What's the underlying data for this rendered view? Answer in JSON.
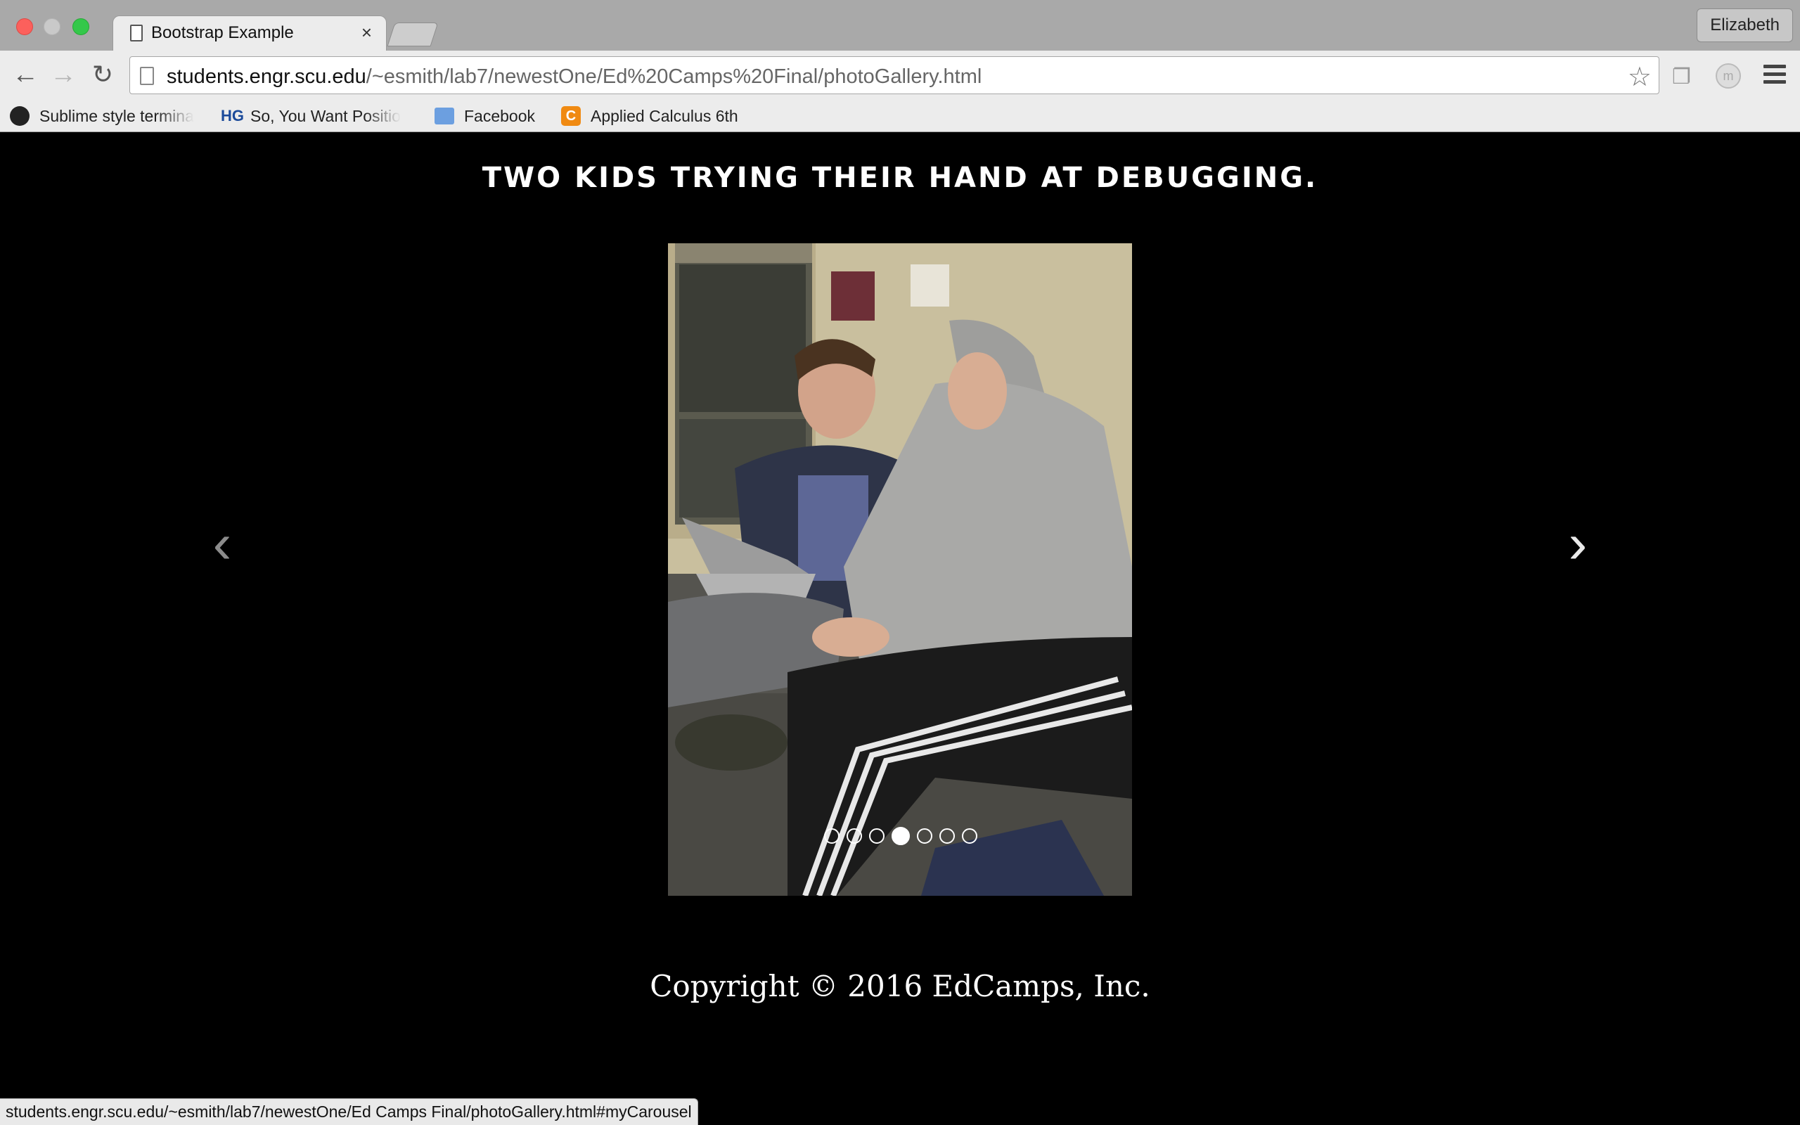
{
  "window": {
    "tab_title": "Bootstrap Example",
    "tab_close": "×",
    "profile_name": "Elizabeth"
  },
  "toolbar": {
    "back_icon": "←",
    "forward_icon": "→",
    "reload_icon": "↻",
    "url_host": "students.engr.scu.edu",
    "url_path": "/~esmith/lab7/newestOne/Ed%20Camps%20Final/photoGallery.html",
    "star_icon": "☆"
  },
  "bookmarks": [
    {
      "label": "Sublime style termina",
      "icon": "github-icon"
    },
    {
      "label": "So, You Want Positio",
      "icon": "hg-icon",
      "glyph": "HG"
    },
    {
      "label": "Facebook",
      "icon": "folder-icon"
    },
    {
      "label": "Applied Calculus 6th",
      "icon": "c-icon",
      "glyph": "C"
    }
  ],
  "page": {
    "caption": "TWO KIDS TRYING THEIR HAND AT DEBUGGING.",
    "prev_icon": "‹",
    "next_icon": "›",
    "copyright": "Copyright © 2016 EdCamps, Inc."
  },
  "carousel": {
    "slide_count": 7,
    "active_index": 3
  },
  "status_bar": {
    "text": "students.engr.scu.edu/~esmith/lab7/newestOne/Ed Camps Final/photoGallery.html#myCarousel"
  },
  "colors": {
    "page_background": "#000000",
    "text": "#ffffff"
  }
}
